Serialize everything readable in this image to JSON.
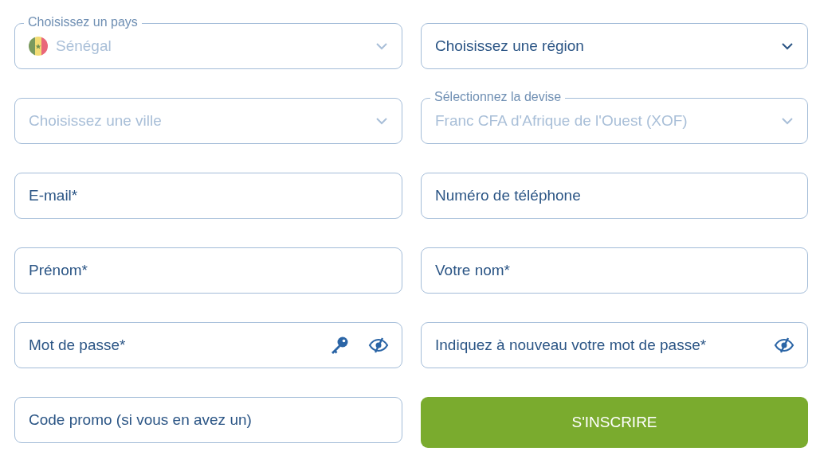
{
  "fields": [
    {
      "kind": "select",
      "label": "Choisissez un pays",
      "value": "Sénégal",
      "flag": true,
      "disabled": true
    },
    {
      "kind": "select",
      "placeholder": "Choisissez une région",
      "disabled": false
    },
    {
      "kind": "select",
      "placeholder": "Choisissez une ville",
      "disabled": true
    },
    {
      "kind": "select",
      "label": "Sélectionnez la devise",
      "value": "Franc CFA d'Afrique de l'Ouest (XOF)",
      "disabled": true
    },
    {
      "kind": "text",
      "placeholder": "E-mail*"
    },
    {
      "kind": "text",
      "placeholder": "Numéro de téléphone"
    },
    {
      "kind": "text",
      "placeholder": "Prénom*"
    },
    {
      "kind": "text",
      "placeholder": "Votre nom*"
    },
    {
      "kind": "password",
      "placeholder": "Mot de passe*",
      "generator": true
    },
    {
      "kind": "password",
      "placeholder": "Indiquez à nouveau votre mot de passe*",
      "generator": false
    },
    {
      "kind": "text",
      "placeholder": "Code promo (si vous en avez un)"
    },
    {
      "kind": "button",
      "label": "S'INSCRIRE"
    }
  ]
}
